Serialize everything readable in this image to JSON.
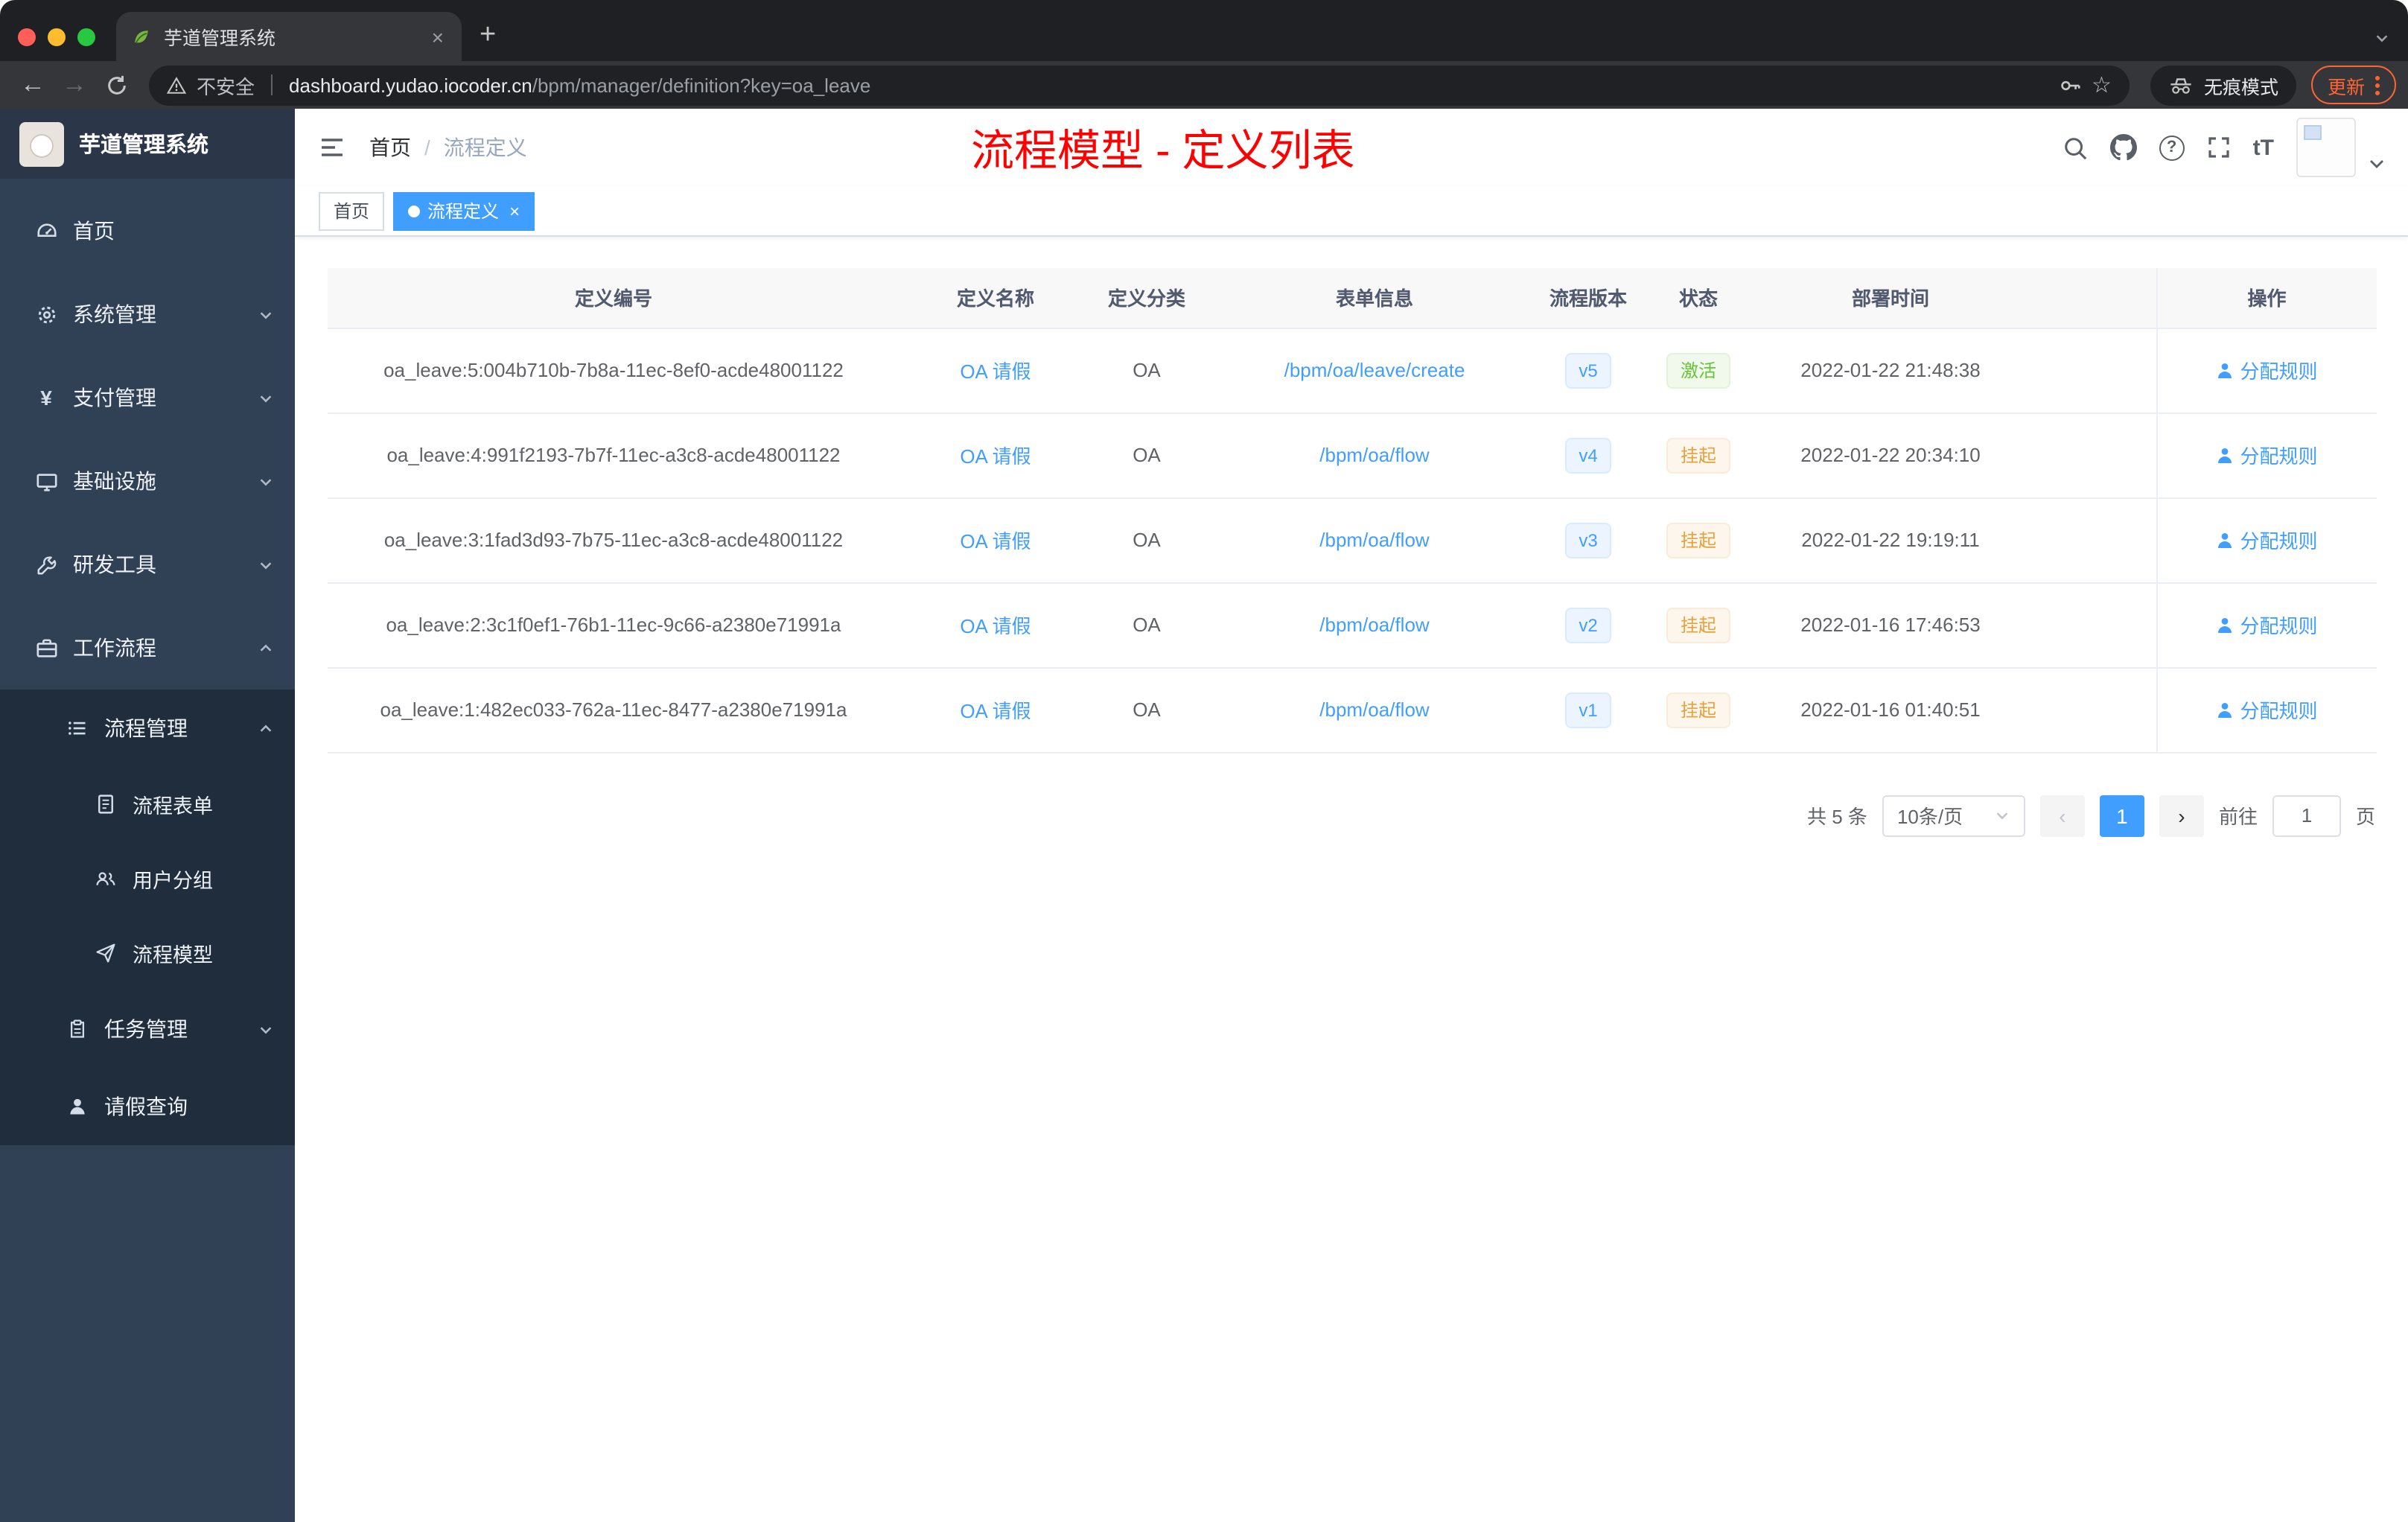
{
  "colors": {
    "accent_blue": "#409eff",
    "annotation_red": "#fe0000",
    "status_active_green": "#67c23a",
    "status_suspend_orange": "#e6a23c",
    "version_tag_blue": "#409eff",
    "sidebar_bg": "#304156",
    "submenu_bg": "#1f2d3d",
    "update_pill_orange": "#ff6434",
    "traffic_red": "#ff5f57",
    "traffic_yellow": "#febc2e",
    "traffic_green": "#28c840"
  },
  "icons": {
    "back": "←",
    "forward": "→",
    "new_tab": "+",
    "close": "×",
    "star": "☆",
    "yen": "¥",
    "help": "?",
    "font_size": "tT"
  },
  "browser": {
    "tab_title": "芋道管理系统",
    "security_label": "不安全",
    "url_host": "dashboard.yudao.iocoder.cn",
    "url_path": "/bpm/manager/definition?key=oa_leave",
    "incognito_label": "无痕模式",
    "update_label": "更新"
  },
  "sidebar": {
    "logo_title": "芋道管理系统",
    "items": [
      {
        "label": "首页",
        "icon": "dashboard-icon"
      },
      {
        "label": "系统管理",
        "icon": "gear-icon"
      },
      {
        "label": "支付管理",
        "icon": "yen-icon"
      },
      {
        "label": "基础设施",
        "icon": "monitor-icon"
      },
      {
        "label": "研发工具",
        "icon": "tool-icon"
      },
      {
        "label": "工作流程",
        "icon": "briefcase-icon"
      }
    ],
    "workflow_children": [
      {
        "label": "流程管理",
        "icon": "list-icon"
      },
      {
        "label": "流程表单",
        "icon": "form-icon"
      },
      {
        "label": "用户分组",
        "icon": "user-group-icon"
      },
      {
        "label": "流程模型",
        "icon": "send-icon"
      },
      {
        "label": "任务管理",
        "icon": "task-icon"
      },
      {
        "label": "请假查询",
        "icon": "user-icon"
      }
    ]
  },
  "header": {
    "breadcrumb": {
      "home": "首页",
      "separator": "/",
      "current": "流程定义"
    },
    "annotation": "流程模型 - 定义列表"
  },
  "tags": {
    "home": "首页",
    "active": "流程定义"
  },
  "table": {
    "headers": [
      "定义编号",
      "定义名称",
      "定义分类",
      "表单信息",
      "流程版本",
      "状态",
      "部署时间",
      "操作"
    ],
    "rows": [
      {
        "id": "oa_leave:5:004b710b-7b8a-11ec-8ef0-acde48001122",
        "name": "OA 请假",
        "category": "OA",
        "form": "/bpm/oa/leave/create",
        "version": "v5",
        "status": "激活",
        "time": "2022-01-22 21:48:38",
        "action": "分配规则"
      },
      {
        "id": "oa_leave:4:991f2193-7b7f-11ec-a3c8-acde48001122",
        "name": "OA 请假",
        "category": "OA",
        "form": "/bpm/oa/flow",
        "version": "v4",
        "status": "挂起",
        "time": "2022-01-22 20:34:10",
        "action": "分配规则"
      },
      {
        "id": "oa_leave:3:1fad3d93-7b75-11ec-a3c8-acde48001122",
        "name": "OA 请假",
        "category": "OA",
        "form": "/bpm/oa/flow",
        "version": "v3",
        "status": "挂起",
        "time": "2022-01-22 19:19:11",
        "action": "分配规则"
      },
      {
        "id": "oa_leave:2:3c1f0ef1-76b1-11ec-9c66-a2380e71991a",
        "name": "OA 请假",
        "category": "OA",
        "form": "/bpm/oa/flow",
        "version": "v2",
        "status": "挂起",
        "time": "2022-01-16 17:46:53",
        "action": "分配规则"
      },
      {
        "id": "oa_leave:1:482ec033-762a-11ec-8477-a2380e71991a",
        "name": "OA 请假",
        "category": "OA",
        "form": "/bpm/oa/flow",
        "version": "v1",
        "status": "挂起",
        "time": "2022-01-16 01:40:51",
        "action": "分配规则"
      }
    ]
  },
  "pagination": {
    "total": "共 5 条",
    "page_size": "10条/页",
    "prev": "‹",
    "page": "1",
    "next": "›",
    "goto": "前往",
    "goto_value": "1",
    "unit": "页"
  }
}
